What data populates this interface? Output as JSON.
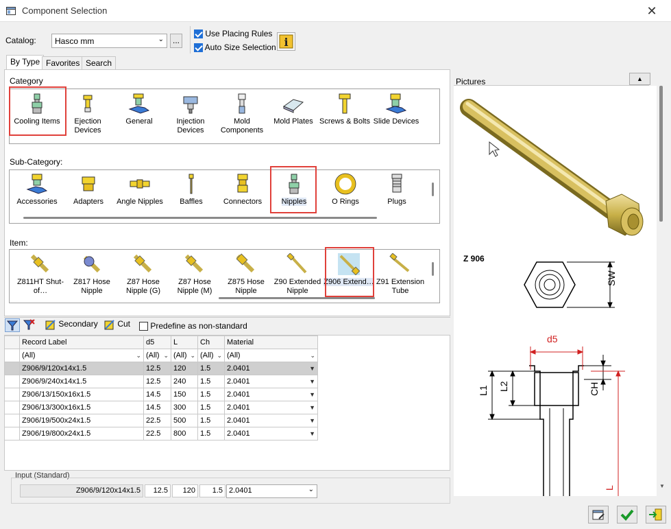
{
  "window": {
    "title": "Component Selection",
    "close": "✕"
  },
  "catalog": {
    "label": "Catalog:",
    "value": "Hasco mm",
    "browse": "..."
  },
  "options": {
    "use_placing_rules": "Use Placing Rules",
    "auto_size": "Auto Size Selection",
    "info": "i"
  },
  "tabs": [
    "By Type",
    "Favorites",
    "Search"
  ],
  "category": {
    "label": "Category",
    "items": [
      {
        "label": "Cooling Items"
      },
      {
        "label": "Ejection Devices"
      },
      {
        "label": "General"
      },
      {
        "label": "Injection Devices"
      },
      {
        "label": "Mold Components"
      },
      {
        "label": "Mold Plates"
      },
      {
        "label": "Screws & Bolts"
      },
      {
        "label": "Slide Devices"
      }
    ]
  },
  "subcategory": {
    "label": "Sub-Category:",
    "items": [
      {
        "label": "Accessories"
      },
      {
        "label": "Adapters"
      },
      {
        "label": "Angle Nipples"
      },
      {
        "label": "Baffles"
      },
      {
        "label": "Connectors"
      },
      {
        "label": "Nipples"
      },
      {
        "label": "O Rings"
      },
      {
        "label": "Plugs"
      }
    ]
  },
  "item": {
    "label": "Item:",
    "items": [
      {
        "label": "Z811HT Shut-of…"
      },
      {
        "label": "Z817 Hose Nipple"
      },
      {
        "label": "Z87 Hose Nipple (G)"
      },
      {
        "label": "Z87 Hose Nipple (M)"
      },
      {
        "label": "Z875 Hose Nipple"
      },
      {
        "label": "Z90 Extended Nipple"
      },
      {
        "label": "Z906 Extend…"
      },
      {
        "label": "Z91 Extension Tube"
      }
    ]
  },
  "toolbar": {
    "secondary": "Secondary",
    "cut": "Cut",
    "predefine": "Predefine as non-standard"
  },
  "table": {
    "headers": [
      "Record Label",
      "d5",
      "L",
      "Ch",
      "Material"
    ],
    "filters": [
      "(All)",
      "(All)",
      "(All)",
      "(All)",
      "(All)"
    ],
    "rows": [
      [
        "Z906/9/120x14x1.5",
        "12.5",
        "120",
        "1.5",
        "2.0401"
      ],
      [
        "Z906/9/240x14x1.5",
        "12.5",
        "240",
        "1.5",
        "2.0401"
      ],
      [
        "Z906/13/150x16x1.5",
        "14.5",
        "150",
        "1.5",
        "2.0401"
      ],
      [
        "Z906/13/300x16x1.5",
        "14.5",
        "300",
        "1.5",
        "2.0401"
      ],
      [
        "Z906/19/500x24x1.5",
        "22.5",
        "500",
        "1.5",
        "2.0401"
      ],
      [
        "Z906/19/800x24x1.5",
        "22.5",
        "800",
        "1.5",
        "2.0401"
      ]
    ]
  },
  "input": {
    "label": "Input (Standard)",
    "record": "Z906/9/120x14x1.5",
    "d5": "12.5",
    "l": "120",
    "ch": "1.5",
    "material": "2.0401"
  },
  "pictures": {
    "label": "Pictures",
    "drawing_title": "Z 906",
    "dims": {
      "sw": "SW",
      "d5": "d5",
      "l1": "L1",
      "l2": "L2",
      "ch": "CH",
      "l": "L"
    }
  },
  "colors": {
    "accent": "#1f6fd6",
    "highlight": "#e0403a",
    "brass": "#c8b048"
  }
}
